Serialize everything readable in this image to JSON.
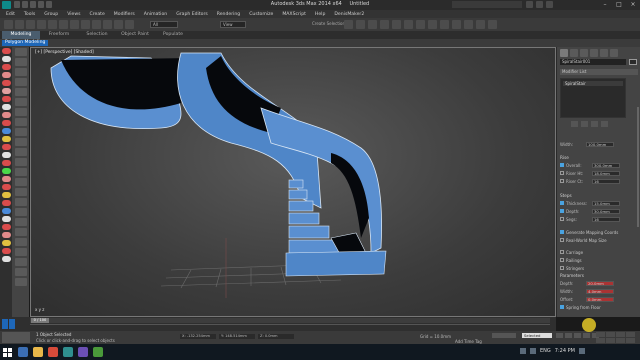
{
  "window": {
    "title_app": "Autodesk 3ds Max  2014 x64",
    "title_file": "Untitled"
  },
  "menubar": {
    "items": [
      "Edit",
      "Tools",
      "Group",
      "Views",
      "Create",
      "Modifiers",
      "Animation",
      "Graph Editors",
      "Rendering",
      "Customize",
      "MAXScript",
      "Help",
      "DenisMaker2"
    ]
  },
  "toolbar": {
    "selection_filter": "All",
    "view_dropdown": "View",
    "named_selection": "Create Selection Se"
  },
  "ribbon": {
    "tabs": [
      "Modeling",
      "Freeform",
      "Selection",
      "Object Paint",
      "Populate"
    ],
    "active_tab": "Modeling",
    "sub_label": "Polygon Modeling"
  },
  "viewport": {
    "label": "[+] [Perspective] [Shaded]",
    "axis": "x y z"
  },
  "command_panel": {
    "object_name": "SpiralStair001",
    "modifier_list": "Modifier List",
    "stack_item": "SpiralStair",
    "width_label": "Width:",
    "width_value": "100.0mm",
    "rise_label": "Rise",
    "rise_rows": [
      {
        "label": "Overall:",
        "value": "300.0mm"
      },
      {
        "label": "Riser Ht:",
        "value": "18.0mm"
      },
      {
        "label": "Riser Ct:",
        "value": "16"
      }
    ],
    "steps_label": "Steps",
    "steps_rows": [
      {
        "label": "Thickness:",
        "value": "15.0mm"
      },
      {
        "label": "Depth:",
        "value": "30.0mm"
      },
      {
        "label": "Segs:",
        "value": "16"
      }
    ],
    "gen_mapping": "Generate Mapping Coords",
    "real_world": "Real-World Map Size",
    "carriage_rows": [
      "Carriage",
      "Railings",
      "Stringers"
    ],
    "params_label": "Parameters",
    "param_rows": [
      {
        "label": "Depth:",
        "value": "20.0mm"
      },
      {
        "label": "Width:",
        "value": "4.0mm"
      },
      {
        "label": "Offset:",
        "value": "0.0mm"
      }
    ],
    "spring_label": "Spring from Floor",
    "set_key": "Set Key"
  },
  "timeline": {
    "frame": "0 / 100"
  },
  "status": {
    "line1": "1 Object Selected",
    "line2": "Click or click-and-drag to select objects",
    "x": "X: -132.254mm",
    "y": "Y: 148.514mm",
    "z": "Z: 0.0mm",
    "grid": "Grid = 10.0mm",
    "add_tag": "Add Time Tag",
    "selected": "Selected",
    "autokey": "Auto Key"
  },
  "taskbar": {
    "lang": "ENG",
    "clock": "7:24 PM"
  },
  "colors": {
    "accent": "#1e67b8",
    "stair_blue": "#5a8fd0",
    "viewport_bg": "#454545"
  }
}
